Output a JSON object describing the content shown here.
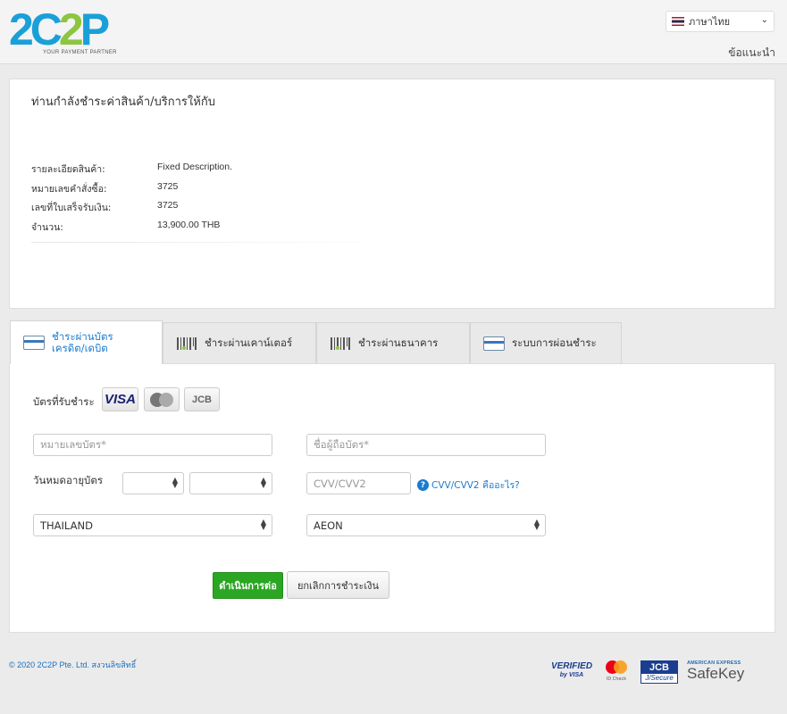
{
  "header": {
    "logo_main_a": "2C",
    "logo_main_b": "2",
    "logo_main_c": "P",
    "logo_tagline": "YOUR PAYMENT PARTNER",
    "language": "ภาษาไทย",
    "help_link": "ข้อแนะนำ"
  },
  "merchant": {
    "title": "ท่านกำลังชำระค่าสินค้า/บริการให้กับ",
    "rows": [
      {
        "label": "รายละเอียดสินค้า:",
        "value": "Fixed Description."
      },
      {
        "label": "หมายเลขคำสั่งซื้อ:",
        "value": "3725"
      },
      {
        "label": "เลขที่ใบเสร็จรับเงิน:",
        "value": "3725"
      },
      {
        "label": "จำนวน:",
        "value": "13,900.00 THB"
      }
    ]
  },
  "tabs": [
    {
      "label_line1": "ชำระผ่านบัตร",
      "label_line2": "เครดิต/เดบิต",
      "icon": "credit-card-icon",
      "active": true
    },
    {
      "label": "ชำระผ่านเคาน์เตอร์",
      "icon": "barcode-icon",
      "active": false
    },
    {
      "label": "ชำระผ่านธนาคาร",
      "icon": "barcode-icon",
      "active": false
    },
    {
      "label": "ระบบการผ่อนชำระ",
      "icon": "credit-card-icon",
      "active": false
    }
  ],
  "form": {
    "accepted_cards_label": "บัตรที่รับชำระ",
    "accepted_cards": [
      "VISA",
      "mastercard",
      "JCB"
    ],
    "card_number_placeholder": "หมายเลขบัตร*",
    "card_holder_placeholder": "ชื่อผู้ถือบัตร*",
    "expiry_label": "วันหมดอายุบัตร",
    "expiry_month_value": "",
    "expiry_year_value": "",
    "cvv_placeholder": "CVV/CVV2",
    "cvv_help": "CVV/CVV2 คืออะไร?",
    "country_value": "THAILAND",
    "issuer_value": "AEON",
    "continue_button": "ดำเนินการต่อ",
    "cancel_button": "ยกเลิกการชำระเงิน"
  },
  "footer": {
    "copyright": "© 2020 2C2P Pte. Ltd. สงวนลิขสิทธิ์",
    "badges": {
      "vbv_line1": "VERIFIED",
      "vbv_line2": "by VISA",
      "mc_text": "ID Check",
      "jcb_line1": "JCB",
      "jcb_line2": "J/Secure",
      "amex_line1": "AMERICAN EXPRESS",
      "amex_line2": "SafeKey"
    }
  },
  "colors": {
    "accent_blue": "#1a7bd0",
    "continue_green": "#2aa623",
    "logo_blue": "#1aa0d8",
    "logo_green": "#8cc63f"
  }
}
